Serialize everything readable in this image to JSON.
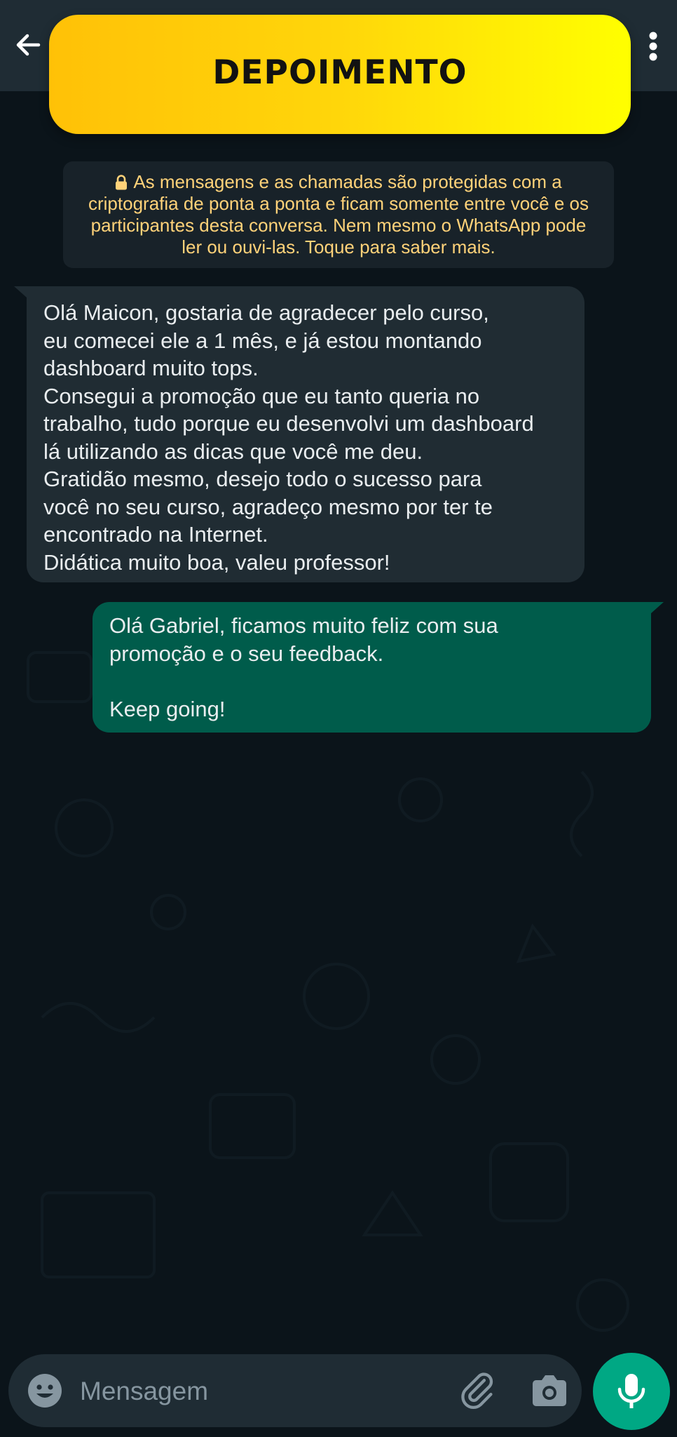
{
  "header": {
    "banner_title": "DEPOIMENTO",
    "back_icon": "arrow-left-icon",
    "menu_icon": "more-vertical-icon"
  },
  "encryption_notice": {
    "icon": "lock-icon",
    "lines": [
      "As mensagens e as chamadas são protegidas com a",
      "criptografia de ponta a ponta e ficam somente entre você e os",
      "participantes desta conversa. Nem mesmo o WhatsApp pode",
      "ler ou ouvi-las. Toque para saber mais."
    ]
  },
  "messages": [
    {
      "direction": "incoming",
      "lines": [
        "Olá Maicon, gostaria de agradecer pelo curso,",
        "eu comecei ele a 1 mês, e já estou montando",
        "dashboard muito tops.",
        "Consegui a promoção que eu tanto queria no",
        "trabalho, tudo porque eu desenvolvi um dashboard",
        "lá utilizando as dicas que você me deu.",
        "Gratidão mesmo, desejo todo o sucesso para",
        "você no seu curso, agradeço mesmo por ter te",
        "encontrado na Internet.",
        "Didática muito boa, valeu professor!"
      ]
    },
    {
      "direction": "outgoing",
      "lines": [
        "Olá Gabriel, ficamos muito feliz com sua",
        "promoção e o seu feedback.",
        "",
        "Keep going!"
      ]
    }
  ],
  "composer": {
    "placeholder": "Mensagem",
    "emoji_icon": "emoji-icon",
    "attach_icon": "paperclip-icon",
    "camera_icon": "camera-icon",
    "mic_icon": "microphone-icon"
  },
  "colors": {
    "background": "#0b141a",
    "header": "#1f2c34",
    "banner_gradient_start": "#ffc107",
    "banner_gradient_end": "#ffff00",
    "notice_text": "#ffd279",
    "incoming_bubble": "#202c33",
    "outgoing_bubble": "#005c4b",
    "accent": "#00a884"
  }
}
